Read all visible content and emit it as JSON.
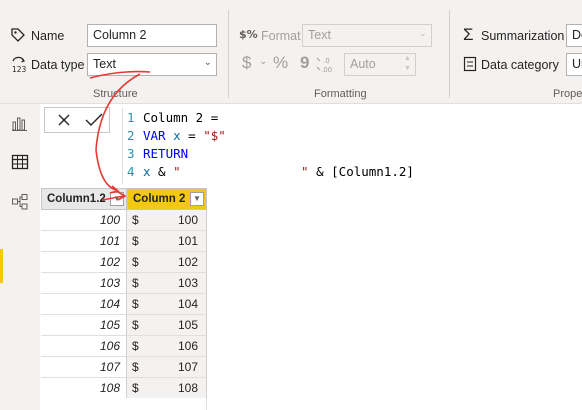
{
  "ribbon": {
    "structure": {
      "name_label": "Name",
      "name_value": "Column 2",
      "datatype_label": "Data type",
      "datatype_value": "Text",
      "group_label": "Structure"
    },
    "formatting": {
      "format_label": "Format",
      "format_value": "Text",
      "currency_symbol": "$",
      "percent_symbol": "%",
      "comma_symbol": "9",
      "decimals_value": "Auto",
      "group_label": "Formatting"
    },
    "properties": {
      "summarization_label": "Summarization",
      "summarization_value": "Do",
      "category_label": "Data category",
      "category_value": "Ur",
      "group_label": "Prope"
    }
  },
  "formula": {
    "lines": [
      {
        "num": "1",
        "a": "Column 2 =",
        "b": "",
        "c": "",
        "d": ""
      },
      {
        "num": "2",
        "a": "VAR ",
        "b": "x",
        "c": " = ",
        "d": "\"$\""
      },
      {
        "num": "3",
        "a": "RETURN",
        "b": "",
        "c": "",
        "d": ""
      },
      {
        "num": "4",
        "a": "x",
        "b": " & ",
        "c": "\"                \"",
        "d": " & [Column1.2]"
      }
    ]
  },
  "table": {
    "headers": [
      "Column1.2",
      "Column 2"
    ],
    "rows": [
      {
        "c1": "100",
        "cur": "$",
        "amt": "100"
      },
      {
        "c1": "101",
        "cur": "$",
        "amt": "101"
      },
      {
        "c1": "102",
        "cur": "$",
        "amt": "102"
      },
      {
        "c1": "103",
        "cur": "$",
        "amt": "103"
      },
      {
        "c1": "104",
        "cur": "$",
        "amt": "104"
      },
      {
        "c1": "105",
        "cur": "$",
        "amt": "105"
      },
      {
        "c1": "106",
        "cur": "$",
        "amt": "106"
      },
      {
        "c1": "107",
        "cur": "$",
        "amt": "107"
      },
      {
        "c1": "108",
        "cur": "$",
        "amt": "108"
      }
    ]
  },
  "colors": {
    "accent": "#f2c811",
    "annotation": "#e53935",
    "keyword": "#0000ff",
    "string": "#a31515"
  }
}
